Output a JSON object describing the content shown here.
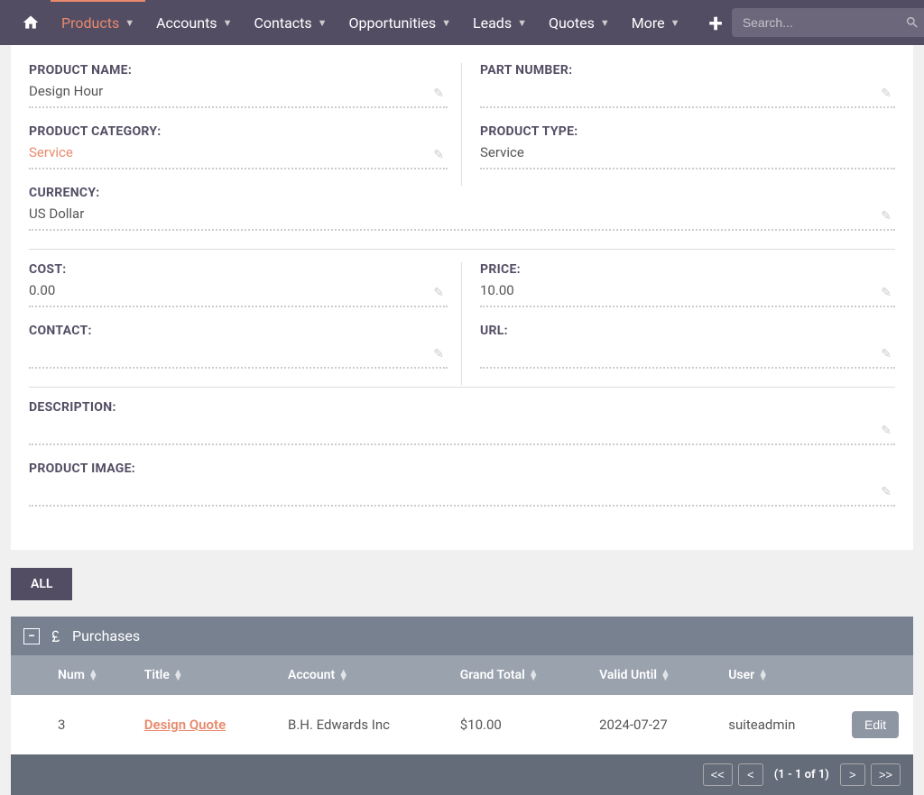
{
  "nav": {
    "items": [
      "Products",
      "Accounts",
      "Contacts",
      "Opportunities",
      "Leads",
      "Quotes",
      "More"
    ],
    "search_placeholder": "Search..."
  },
  "details": {
    "product_name": {
      "label": "PRODUCT NAME:",
      "value": "Design Hour"
    },
    "part_number": {
      "label": "PART NUMBER:",
      "value": ""
    },
    "product_category": {
      "label": "PRODUCT CATEGORY:",
      "value": "Service"
    },
    "product_type": {
      "label": "PRODUCT TYPE:",
      "value": "Service"
    },
    "currency": {
      "label": "CURRENCY:",
      "value": "US Dollar"
    },
    "cost": {
      "label": "COST:",
      "value": "0.00"
    },
    "price": {
      "label": "PRICE:",
      "value": "10.00"
    },
    "contact": {
      "label": "CONTACT:",
      "value": ""
    },
    "url": {
      "label": "URL:",
      "value": ""
    },
    "description": {
      "label": "DESCRIPTION:",
      "value": ""
    },
    "product_image": {
      "label": "PRODUCT IMAGE:",
      "value": ""
    }
  },
  "tabs": {
    "all": "ALL"
  },
  "panel": {
    "title": "Purchases",
    "columns": [
      "Num",
      "Title",
      "Account",
      "Grand Total",
      "Valid Until",
      "User"
    ],
    "rows": [
      {
        "num": "3",
        "title": "Design Quote",
        "account": "B.H. Edwards Inc",
        "grand_total": "$10.00",
        "valid_until": "2024-07-27",
        "user": "suiteadmin"
      }
    ],
    "edit_label": "Edit",
    "pagination": {
      "first": "<<",
      "prev": "<",
      "info": "(1 - 1 of 1)",
      "next": ">",
      "last": ">>"
    }
  }
}
